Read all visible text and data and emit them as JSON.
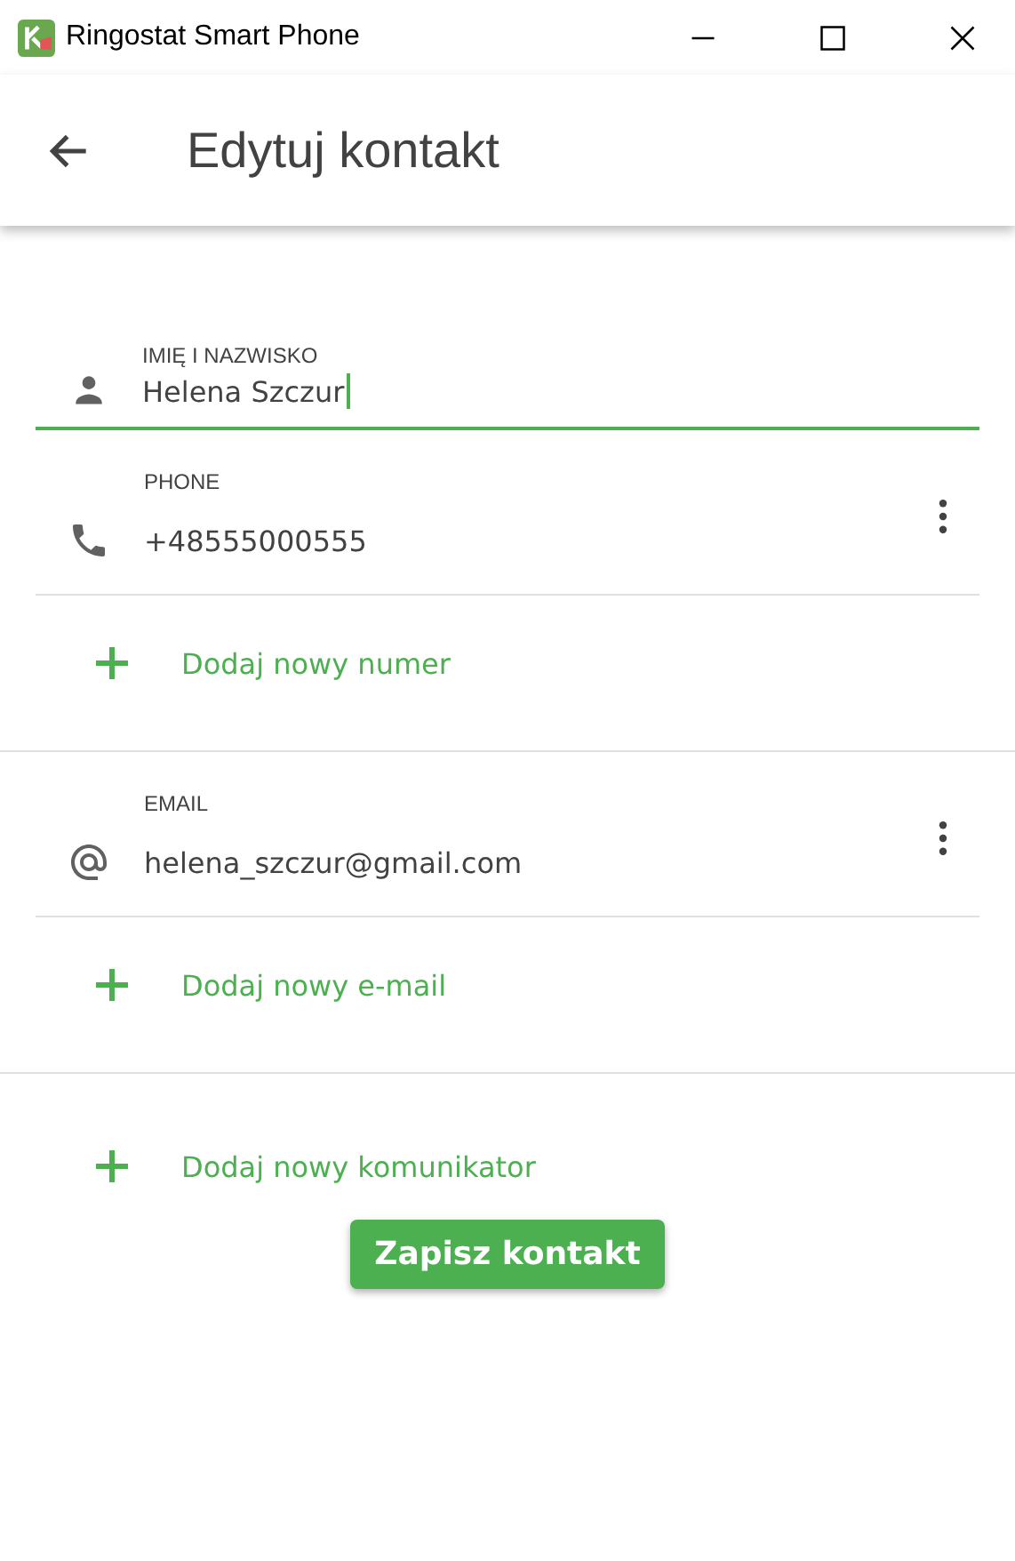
{
  "window": {
    "title": "Ringostat Smart Phone"
  },
  "header": {
    "title": "Edytuj kontakt"
  },
  "name_field": {
    "label": "IMIĘ I NAZWISKO",
    "value": "Helena Szczur",
    "focused": true
  },
  "sections": [
    {
      "kind": "phone",
      "label": "PHONE",
      "value": "+48555000555",
      "add_label": "Dodaj nowy numer"
    },
    {
      "kind": "email",
      "label": "EMAIL",
      "value": "helena_szczur@gmail.com",
      "add_label": "Dodaj nowy e-mail"
    }
  ],
  "add_messenger": "Dodaj nowy komunikator",
  "save_button": "Zapisz kontakt"
}
